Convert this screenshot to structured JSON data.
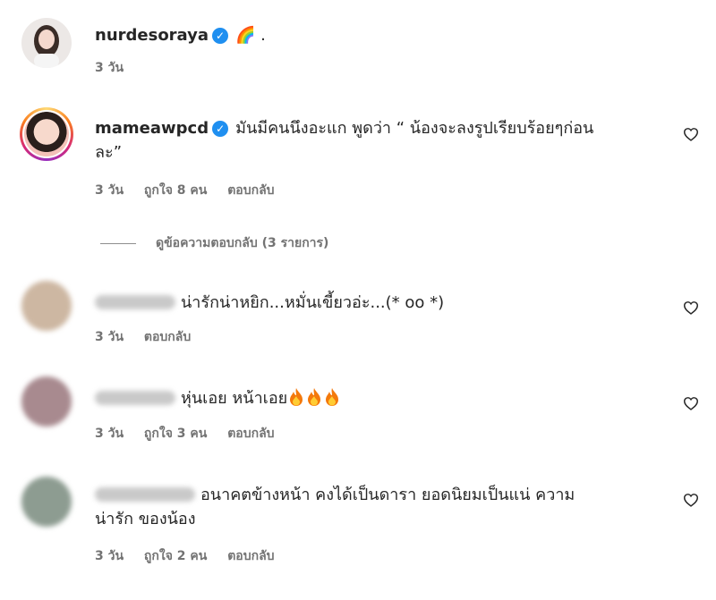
{
  "comments": [
    {
      "username": "nurdesoraya",
      "text": "🌈 .",
      "time": "3 วัน"
    },
    {
      "username": "mameawpcd",
      "text_line1": "มันมีคนนึงอะแก พูดว่า “ น้องจะลงรูปเรียบร้อยๆก่อน",
      "text_line2": "ละ”",
      "time": "3 วัน",
      "likes": "ถูกใจ 8 คน",
      "reply": "ตอบกลับ"
    },
    {
      "username_hidden": true,
      "text": "น่ารักน่าหยิก...หมั่นเขี้ยวอ่ะ...(* oo *)",
      "time": "3 วัน",
      "reply": "ตอบกลับ"
    },
    {
      "username_hidden": true,
      "text": "หุ่นเอย หน้าเอย",
      "time": "3 วัน",
      "likes": "ถูกใจ 3 คน",
      "reply": "ตอบกลับ"
    },
    {
      "username_hidden": true,
      "text_line1": "อนาคตข้างหน้า คงได้เป็นดารา ยอดนิยมเป็นแน่ ความ",
      "text_line2": "น่ารัก ของน้อง",
      "time": "3 วัน",
      "likes": "ถูกใจ 2 คน",
      "reply": "ตอบกลับ"
    }
  ],
  "view_replies": "ดูข้อความตอบกลับ (3 รายการ)",
  "icons": {
    "verified": "verified-badge-icon",
    "like": "heart-outline-icon",
    "flame": "fire-emoji-icon"
  },
  "colors": {
    "text": "#262626",
    "meta": "#737373",
    "verified": "#1f8ff0"
  }
}
